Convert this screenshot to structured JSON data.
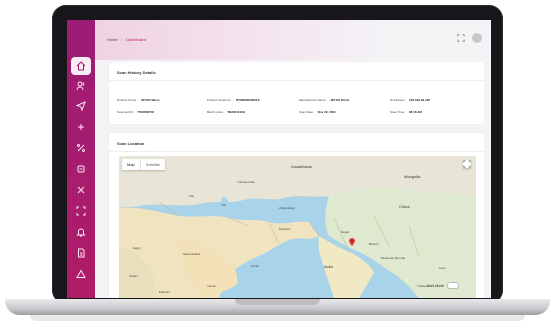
{
  "breadcrumb": {
    "home": "Home",
    "separator": ">",
    "current": "Dashboard"
  },
  "scan_history": {
    "title": "Scan History Details",
    "fields": [
      {
        "key": "Product Name :",
        "value": "JETSO Wires"
      },
      {
        "key": "Product Serial No. :",
        "value": "RTSN80000001S"
      },
      {
        "key": "Manufacturer Name :",
        "value": "JETSO Drivlo"
      },
      {
        "key": "IP Address :",
        "value": "223.199.28.13P"
      },
      {
        "key": "Scanned ID :",
        "value": "7506658702"
      },
      {
        "key": "Batch Code :",
        "value": "TB2021110G"
      },
      {
        "key": "Scan Date :",
        "value": "Nov 22, 2021"
      },
      {
        "key": "Scan Time :",
        "value": "08:18 AM"
      }
    ]
  },
  "scan_location": {
    "title": "Scan Location",
    "map_tabs": {
      "map": "Map",
      "satellite": "Satellite"
    },
    "labels": {
      "kazakhstan": "Kazakhstan",
      "mongolia": "Mongolia",
      "turkmenistan": "Turkmenistan",
      "afghanistan": "Afghanistan",
      "china": "China",
      "iran": "Iran",
      "iraq": "Iraq",
      "pakistan": "Pakistan",
      "nepal": "Nepal",
      "india": "India",
      "myanmar": "Myanmar (Burma)",
      "thailand": "Thailand",
      "saudi": "Saudi Arabia",
      "egypt": "Egypt",
      "oman": "Oman",
      "yemen": "Yemen",
      "sudan": "Sudan",
      "ethiopia": "Ethiopia",
      "bhutan": "Bhutan",
      "laos": "Laos"
    },
    "dark_mode": "Dark Mode"
  },
  "colors": {
    "sidebar": "#a61d6f",
    "accent": "#c2185b",
    "pin": "#e53935"
  }
}
